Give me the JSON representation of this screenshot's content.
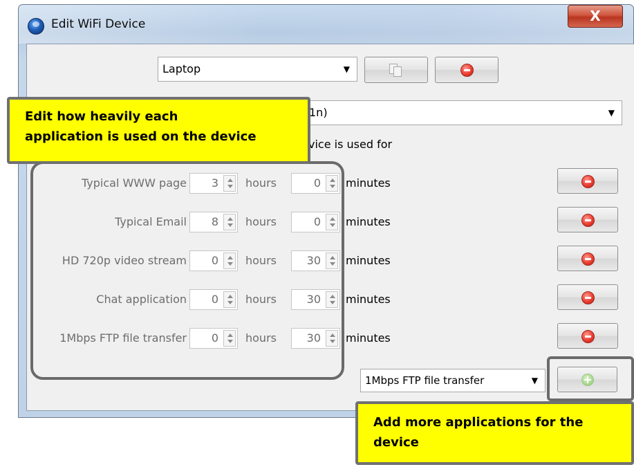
{
  "window": {
    "title": "Edit WiFi Device",
    "close_label": "X"
  },
  "device": {
    "selected": "Laptop"
  },
  "radio_combo": {
    "value_partial": "1n)"
  },
  "usage_header_partial": "vice is used for",
  "units": {
    "hours": "hours",
    "minutes": "minutes"
  },
  "applications": [
    {
      "name": "Typical WWW page",
      "hours": "3",
      "minutes": "0"
    },
    {
      "name": "Typical Email",
      "hours": "8",
      "minutes": "0"
    },
    {
      "name": "HD 720p video stream",
      "hours": "0",
      "minutes": "30"
    },
    {
      "name": "Chat application",
      "hours": "0",
      "minutes": "30"
    },
    {
      "name": "1Mbps FTP file transfer",
      "hours": "0",
      "minutes": "30"
    }
  ],
  "add_app": {
    "selected": "1Mbps FTP file transfer"
  },
  "callouts": {
    "edit_usage": [
      "Edit how heavily each",
      "application  is used on the device"
    ],
    "add_more": [
      "Add more applications  for the",
      "device"
    ]
  },
  "icons": {
    "app": "globe-app-icon",
    "copy": "copy-icon",
    "remove": "remove-icon",
    "add": "add-icon",
    "dropdown": "chevron-down-icon"
  },
  "colors": {
    "callout_bg": "#ffff00",
    "remove_red": "#ea3d31",
    "add_green": "#a9d98f",
    "close_red": "#c9432d"
  }
}
